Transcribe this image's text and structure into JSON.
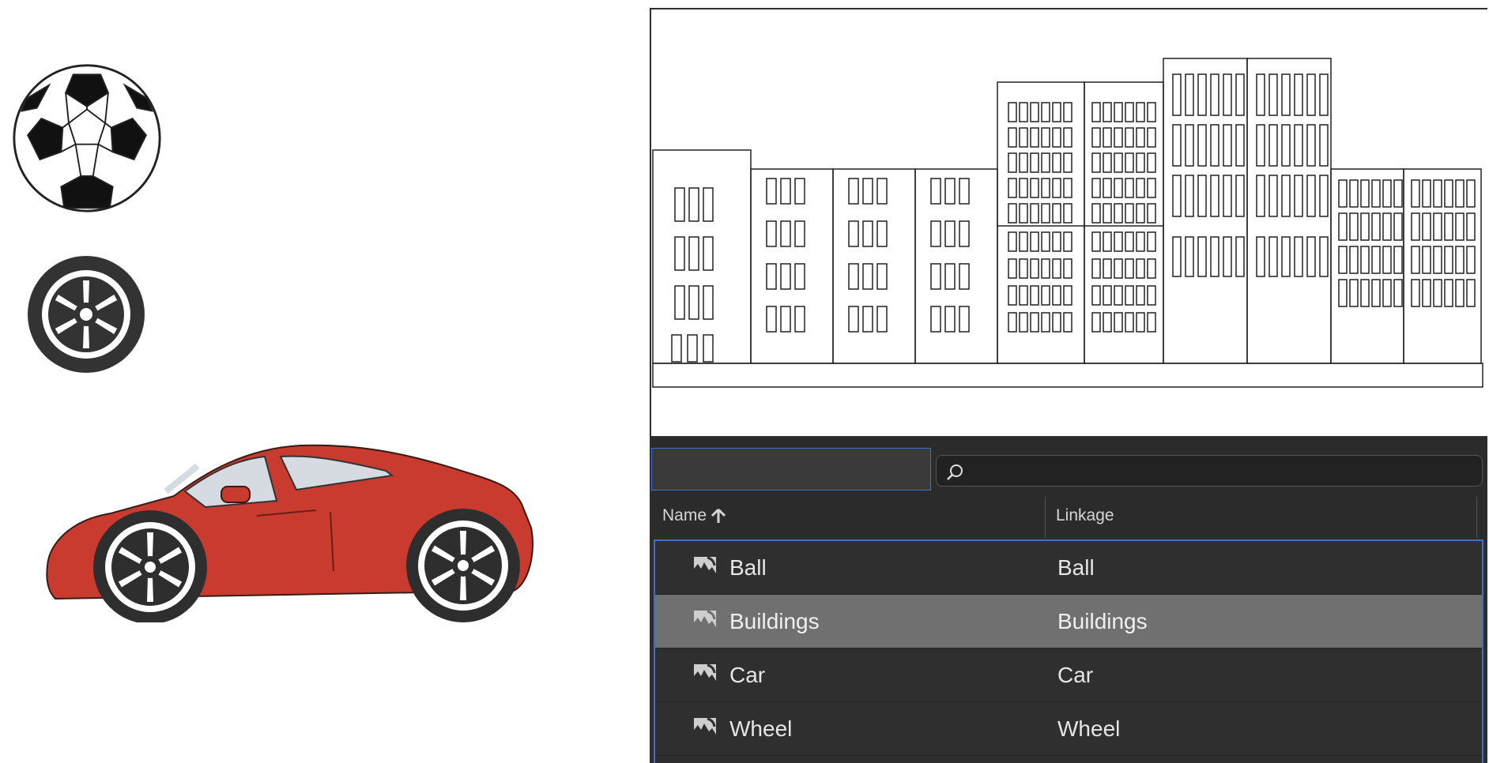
{
  "stage": {
    "items": [
      {
        "id": "soccer-ball",
        "icon": "soccer-ball-illustration"
      },
      {
        "id": "wheel",
        "icon": "wheel-illustration"
      },
      {
        "id": "red-sports-car",
        "icon": "car-illustration"
      }
    ]
  },
  "library": {
    "preview_icon": "buildings-illustration",
    "search": {
      "placeholder": "",
      "icon": "search-icon"
    },
    "columns": {
      "name": "Name",
      "linkage": "Linkage",
      "sort_icon": "arrow-up-icon"
    },
    "symbol_icon": "movie-clip-symbol-icon",
    "items": [
      {
        "name": "Ball",
        "linkage": "Ball",
        "selected": false
      },
      {
        "name": "Buildings",
        "linkage": "Buildings",
        "selected": true
      },
      {
        "name": "Car",
        "linkage": "Car",
        "selected": false
      },
      {
        "name": "Wheel",
        "linkage": "Wheel",
        "selected": false
      }
    ]
  },
  "colors": {
    "panel_bg": "#2d2d2d",
    "selected_row": "#707070",
    "focus_border": "#3d6fc7",
    "car_red": "#c93b2e"
  }
}
